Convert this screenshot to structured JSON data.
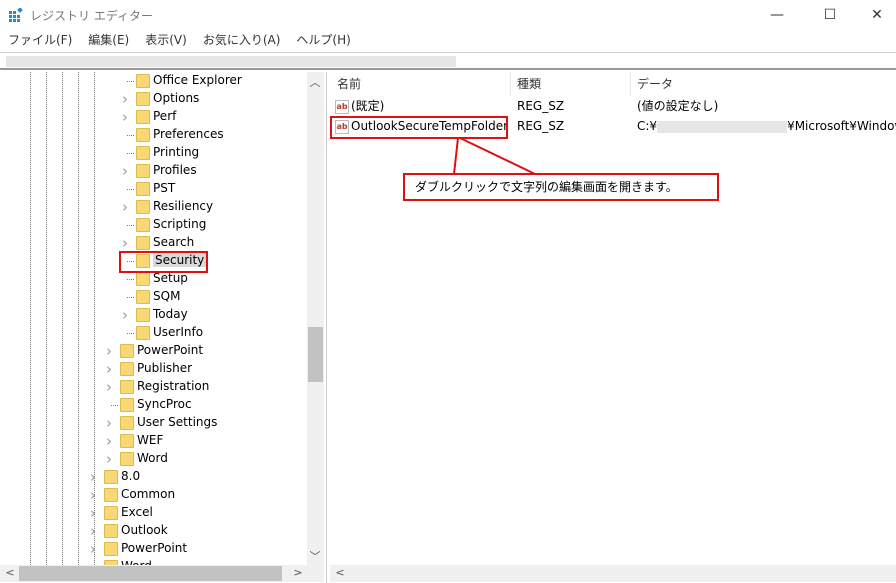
{
  "window": {
    "title": "レジストリ エディター",
    "minimize": "—",
    "maximize": "☐",
    "close": "✕"
  },
  "menu": [
    "ファイル(F)",
    "編集(E)",
    "表示(V)",
    "お気に入り(A)",
    "ヘルプ(H)"
  ],
  "tree": {
    "items": [
      {
        "label": "Office Explorer",
        "level": 3,
        "expandable": false
      },
      {
        "label": "Options",
        "level": 3,
        "expandable": true
      },
      {
        "label": "Perf",
        "level": 3,
        "expandable": true
      },
      {
        "label": "Preferences",
        "level": 3,
        "expandable": false
      },
      {
        "label": "Printing",
        "level": 3,
        "expandable": false
      },
      {
        "label": "Profiles",
        "level": 3,
        "expandable": true
      },
      {
        "label": "PST",
        "level": 3,
        "expandable": false
      },
      {
        "label": "Resiliency",
        "level": 3,
        "expandable": true
      },
      {
        "label": "Scripting",
        "level": 3,
        "expandable": false
      },
      {
        "label": "Search",
        "level": 3,
        "expandable": true
      },
      {
        "label": "Security",
        "level": 3,
        "expandable": false,
        "selected": true
      },
      {
        "label": "Setup",
        "level": 3,
        "expandable": false
      },
      {
        "label": "SQM",
        "level": 3,
        "expandable": false
      },
      {
        "label": "Today",
        "level": 3,
        "expandable": true
      },
      {
        "label": "UserInfo",
        "level": 3,
        "expandable": false
      },
      {
        "label": "PowerPoint",
        "level": 2,
        "expandable": true
      },
      {
        "label": "Publisher",
        "level": 2,
        "expandable": true
      },
      {
        "label": "Registration",
        "level": 2,
        "expandable": true
      },
      {
        "label": "SyncProc",
        "level": 2,
        "expandable": false
      },
      {
        "label": "User Settings",
        "level": 2,
        "expandable": true
      },
      {
        "label": "WEF",
        "level": 2,
        "expandable": true
      },
      {
        "label": "Word",
        "level": 2,
        "expandable": true
      },
      {
        "label": "8.0",
        "level": 1,
        "expandable": true
      },
      {
        "label": "Common",
        "level": 1,
        "expandable": true
      },
      {
        "label": "Excel",
        "level": 1,
        "expandable": true
      },
      {
        "label": "Outlook",
        "level": 1,
        "expandable": true
      },
      {
        "label": "PowerPoint",
        "level": 1,
        "expandable": true
      },
      {
        "label": "Word",
        "level": 1,
        "expandable": true
      }
    ]
  },
  "values": {
    "columns": {
      "name": "名前",
      "type": "種類",
      "data": "データ"
    },
    "rows": [
      {
        "name": "(既定)",
        "type": "REG_SZ",
        "data": "(値の設定なし)"
      },
      {
        "name": "OutlookSecureTempFolder",
        "type": "REG_SZ",
        "data_prefix": "C:¥",
        "data_suffix": "¥Microsoft¥Window"
      }
    ]
  },
  "annotation": {
    "text": "ダブルクリックで文字列の編集画面を開きます。",
    "color": "#dd1111"
  }
}
